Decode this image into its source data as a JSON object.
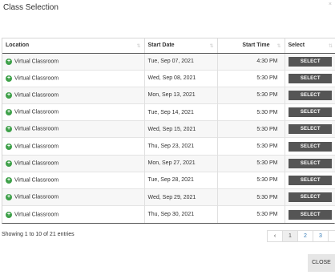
{
  "modal": {
    "title": "Class Selection",
    "close_icon": "×",
    "close_button_label": "CLOSE"
  },
  "table": {
    "columns": [
      "Location",
      "Start Date",
      "Start Time",
      "Select"
    ],
    "sort_icon": "⇅",
    "select_label": "SELECT",
    "rows": [
      {
        "location": "Virtual Classroom",
        "start_date": "Tue, Sep 07, 2021",
        "start_time": "4:30 PM"
      },
      {
        "location": "Virtual Classroom",
        "start_date": "Wed, Sep 08, 2021",
        "start_time": "5:30 PM"
      },
      {
        "location": "Virtual Classroom",
        "start_date": "Mon, Sep 13, 2021",
        "start_time": "5:30 PM"
      },
      {
        "location": "Virtual Classroom",
        "start_date": "Tue, Sep 14, 2021",
        "start_time": "5:30 PM"
      },
      {
        "location": "Virtual Classroom",
        "start_date": "Wed, Sep 15, 2021",
        "start_time": "5:30 PM"
      },
      {
        "location": "Virtual Classroom",
        "start_date": "Thu, Sep 23, 2021",
        "start_time": "5:30 PM"
      },
      {
        "location": "Virtual Classroom",
        "start_date": "Mon, Sep 27, 2021",
        "start_time": "5:30 PM"
      },
      {
        "location": "Virtual Classroom",
        "start_date": "Tue, Sep 28, 2021",
        "start_time": "5:30 PM"
      },
      {
        "location": "Virtual Classroom",
        "start_date": "Wed, Sep 29, 2021",
        "start_time": "5:30 PM"
      },
      {
        "location": "Virtual Classroom",
        "start_date": "Thu, Sep 30, 2021",
        "start_time": "5:30 PM"
      }
    ]
  },
  "footer": {
    "info": "Showing 1 to 10 of 21 entries",
    "pagination": {
      "prev": "‹",
      "pages": [
        "1",
        "2",
        "3"
      ],
      "active": "1",
      "next": "›"
    }
  },
  "colors": {
    "expand_icon": "#3fa14a",
    "select_button": "#555555",
    "page_link": "#337ab7"
  }
}
